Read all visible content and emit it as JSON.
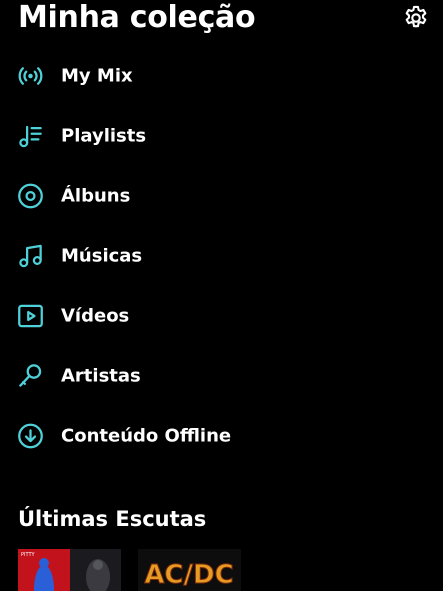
{
  "header": {
    "title": "Minha coleção",
    "settings_icon": "gear-icon"
  },
  "accent_color": "#4FD1D9",
  "menu": {
    "items": [
      {
        "label": "My Mix",
        "icon": "radio-broadcast-icon"
      },
      {
        "label": "Playlists",
        "icon": "playlist-icon"
      },
      {
        "label": "Álbuns",
        "icon": "album-disc-icon"
      },
      {
        "label": "Músicas",
        "icon": "music-note-icon"
      },
      {
        "label": "Vídeos",
        "icon": "video-play-icon"
      },
      {
        "label": "Artistas",
        "icon": "microphone-icon"
      },
      {
        "label": "Conteúdo Offline",
        "icon": "download-circle-icon"
      }
    ]
  },
  "recent": {
    "title": "Últimas Escutas",
    "items": [
      {
        "art_text": "PITTY"
      },
      {
        "art_text": "AC/DC"
      }
    ]
  }
}
